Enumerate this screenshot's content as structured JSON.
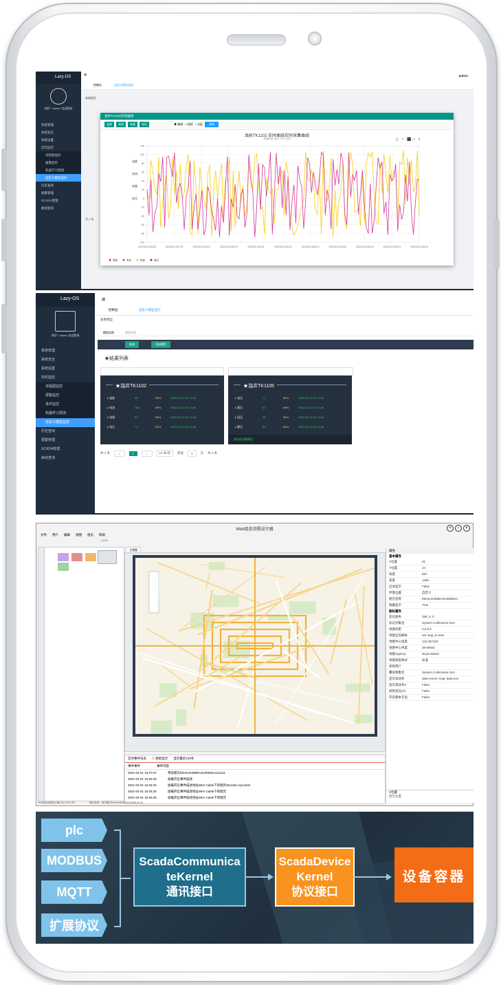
{
  "panel1": {
    "sidebar_logo": "Lazy-OS",
    "sidebar_user": "你好！admin, 欢迎登录",
    "sidebar_items": [
      "系统管理",
      "系统安全",
      "系统设置",
      "实时监控",
      "流程图监控",
      "报警监控",
      "机器学习预测",
      "自定义模型监控",
      "历史查询",
      "报警管理",
      "SCADA管理",
      "曲线查询"
    ],
    "top_user": "admin",
    "tabs": [
      "控制台",
      "自定义模型监控"
    ],
    "breadcrumb": "查看模型",
    "modal_title": "油井TK1102实时曲线",
    "chips": [
      "温度",
      "电流",
      "电量",
      "电压"
    ],
    "radio_options": [
      "曲线",
      "柱状",
      "分区"
    ],
    "query_button": "查询",
    "chart_title": "油井TK1102 实时曲线实时采集曲线",
    "chart_subtitle": "数据来源: 数仓 OPC 仿真",
    "left_labels": [
      "温度",
      "电流",
      "电量",
      "电压"
    ],
    "legend": [
      "温度",
      "电流",
      "电量",
      "电压"
    ],
    "x_ticks": [
      "2022/3/14 8:46:48",
      "2022/3/14 8:57:33",
      "2022/3/14 8:48:27",
      "2022/3/14 8:49:24",
      "2022/3/1 8:50:18",
      "2022/3/14 8:51:12",
      "2022/3/14 8:52:10",
      "2022/3/14 8:53:05",
      "2022/3/14 8:54:00",
      "2022/3/14 9:55:21",
      "2022/3/14 8:56:15"
    ],
    "y_ticks": [
      "125",
      "100",
      "80",
      "60",
      "40",
      "20",
      "0",
      "-20",
      "-40",
      "-60",
      "-80",
      "-100"
    ],
    "pagination": "共 2 条"
  },
  "panel2": {
    "sidebar_logo": "Lazy-OS",
    "sidebar_user": "你好！admin, 欢迎登录",
    "sidebar_items": [
      "系统管理",
      "系统安全",
      "系统设置",
      "实时监控",
      "流程图监控",
      "报警监控",
      "事件监控",
      "机器学习预测",
      "自定义模型监控",
      "历史查询",
      "报警管理",
      "SCADA管理",
      "曲线查询"
    ],
    "tabs": [
      "控制台",
      "自定义模型监控"
    ],
    "breadcrumb": "查看模型",
    "subtabs": [
      "模型实例",
      "模型实例"
    ],
    "buttons": [
      "查询",
      "添加模型"
    ],
    "results_title": "★结果列表",
    "cards": [
      {
        "title": "★油井TK1102",
        "rows": [
          {
            "name": "温度",
            "value": "48",
            "unit": "MPa",
            "time": "2022-03-12 07:13:46"
          },
          {
            "name": "电流",
            "value": "186",
            "unit": "MPa",
            "time": "2022-03-12 07:13:46"
          },
          {
            "name": "电量",
            "value": "62",
            "unit": "MPa",
            "time": "2022-03-12 07:13:46"
          },
          {
            "name": "电压",
            "value": "71",
            "unit": "MPa",
            "time": "2022-03-12 07:13:46"
          }
        ]
      },
      {
        "title": "★油井TK1105",
        "rows": [
          {
            "name": "油压",
            "value": "71",
            "unit": "MPa",
            "time": "2022-03-12 07:13:46"
          },
          {
            "name": "套压",
            "value": "62",
            "unit": "MPa",
            "time": "2022-03-12 07:13:46"
          },
          {
            "name": "回压",
            "value": "46",
            "unit": "MPa",
            "time": "2022-03-12 07:13:46"
          },
          {
            "name": "静压",
            "value": "89",
            "unit": "MPa",
            "time": "2022-03-12 07:13:46"
          }
        ],
        "footer": "测试的设备模型"
      }
    ],
    "pagination": {
      "total": "共 2 条",
      "page": "1",
      "per_page": "10 条/页",
      "goto": "前往",
      "page_input": "1",
      "page_suffix": "页",
      "total2": "共 2 条"
    }
  },
  "panel3": {
    "title": "Web组态流程设计器",
    "menus": [
      "文件",
      "用户",
      "编辑",
      "视图",
      "组态",
      "帮助"
    ],
    "zoom": "100%",
    "canvas_tab": "主视图",
    "left_vtabs": [
      "工业控件",
      "工业图片",
      "图层",
      "交通设施",
      "楼宇"
    ],
    "prop_header": "属性",
    "prop_section1": "基本属性",
    "props1": [
      [
        "X位置",
        "31"
      ],
      [
        "Y位置",
        "24"
      ],
      [
        "高度",
        "687"
      ],
      [
        "宽度",
        "1463"
      ],
      [
        "启动显示",
        "False"
      ],
      [
        "停靠位置",
        "自定义"
      ],
      [
        "图元名称",
        "Element4898A324086814"
      ],
      [
        "隐藏显示",
        "True"
      ]
    ],
    "prop_section2": "图标属性",
    "props2": [
      [
        "变化颜色",
        "255, 0, 0"
      ],
      [
        "标记点集合",
        "System.Collections.Gen"
      ],
      [
        "地图间距",
        "0,0,0,0"
      ],
      [
        "地图全局脚本",
        "var map_0=new"
      ],
      [
        "地图中心经度",
        "116.397428"
      ],
      [
        "地图中心纬度",
        "39.90923"
      ],
      [
        "地图AppKey",
        "lazyscadaoil"
      ],
      [
        "地图类型样式",
        "标准"
      ],
      [
        "权限用户",
        ""
      ],
      [
        "覆盖物集合",
        "System.Collections.Gen"
      ],
      [
        "显示滚动条",
        "data-event='map' data-eve"
      ],
      [
        "显示滚动条X",
        "False"
      ],
      [
        "颜色变化(X)",
        "False"
      ],
      [
        "开启脚本写出",
        "False"
      ]
    ],
    "prop_bottom": "X位置",
    "prop_bottom2": "图元位置",
    "log_toolbar": [
      "实时事件日志",
      "刷新显示",
      "显示最近100条"
    ],
    "log_headers": [
      "事件事件",
      "事件内容"
    ],
    "log_rows": [
      [
        "2021-02-01 15:27:07",
        "预览图元Element4898A324086814111211"
      ],
      [
        "2021-02-01 15:26:25",
        "加载开启事件描述"
      ],
      [
        "2021-02-01 15:26:25",
        "加载开启事件描述地址Wire Cable下的图元Wooden sprocket"
      ],
      [
        "2021-02-01 15:26:25",
        "加载开启事件描述地址Wire Cable下的图元"
      ],
      [
        "2021-02-01 15:26:25",
        "加载开启事件描述地址Wire Cable下的图元"
      ]
    ],
    "status_left": "Web组态流程设计器 大小1239,750",
    "status_right": "图元选择：选中图元Element4898A324086814218"
  },
  "panel4": {
    "protocols": [
      "plc",
      "MODBUS",
      "MQTT",
      "扩展协议"
    ],
    "box1": [
      "ScadaCommunica",
      "teKernel",
      "通讯接口"
    ],
    "box2": [
      "ScadaDevice",
      "Kernel",
      "协议接口"
    ],
    "box3": "设备容器",
    "colors": {
      "proto": "#7fc3ea",
      "box1": "#1e6e8c",
      "box2": "#f7931e",
      "box3": "#f36c16"
    }
  }
}
